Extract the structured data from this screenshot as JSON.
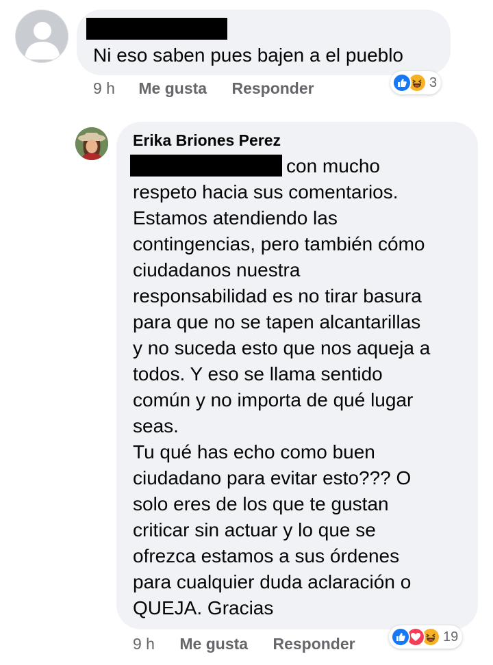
{
  "comment1": {
    "text": "Ni eso saben pues bajen a el pueblo",
    "time": "9 h",
    "like_label": "Me gusta",
    "reply_label": "Responder",
    "reaction_count": "3",
    "reactions": [
      "like-icon",
      "haha-icon"
    ]
  },
  "reply": {
    "author": "Erika Briones Perez",
    "first_line_tail": "con mucho",
    "lines": [
      "respeto hacia sus comentarios.",
      "Estamos atendiendo las",
      "contingencias, pero también cómo",
      "ciudadanos nuestra",
      "responsabilidad es no tirar basura",
      "para que no se tapen alcantarillas",
      "y no suceda esto que nos aqueja a",
      "todos. Y eso se llama sentido",
      "común y no importa de qué lugar",
      "seas.",
      "Tu qué has echo como buen",
      "ciudadano para evitar esto??? O",
      "solo eres de los que te gustan",
      "criticar sin actuar y lo que se",
      "ofrezca estamos a sus órdenes",
      "para cualquier duda aclaración o",
      "QUEJA. Gracias"
    ],
    "time": "9 h",
    "like_label": "Me gusta",
    "reply_label": "Responder",
    "reaction_count": "19",
    "reactions": [
      "like-icon",
      "love-icon",
      "haha-icon"
    ]
  },
  "colors": {
    "bubble": "#f0f2f5",
    "like": "#1877f2",
    "love": "#f33e58",
    "haha": "#f7b125",
    "meta": "#65676b"
  }
}
